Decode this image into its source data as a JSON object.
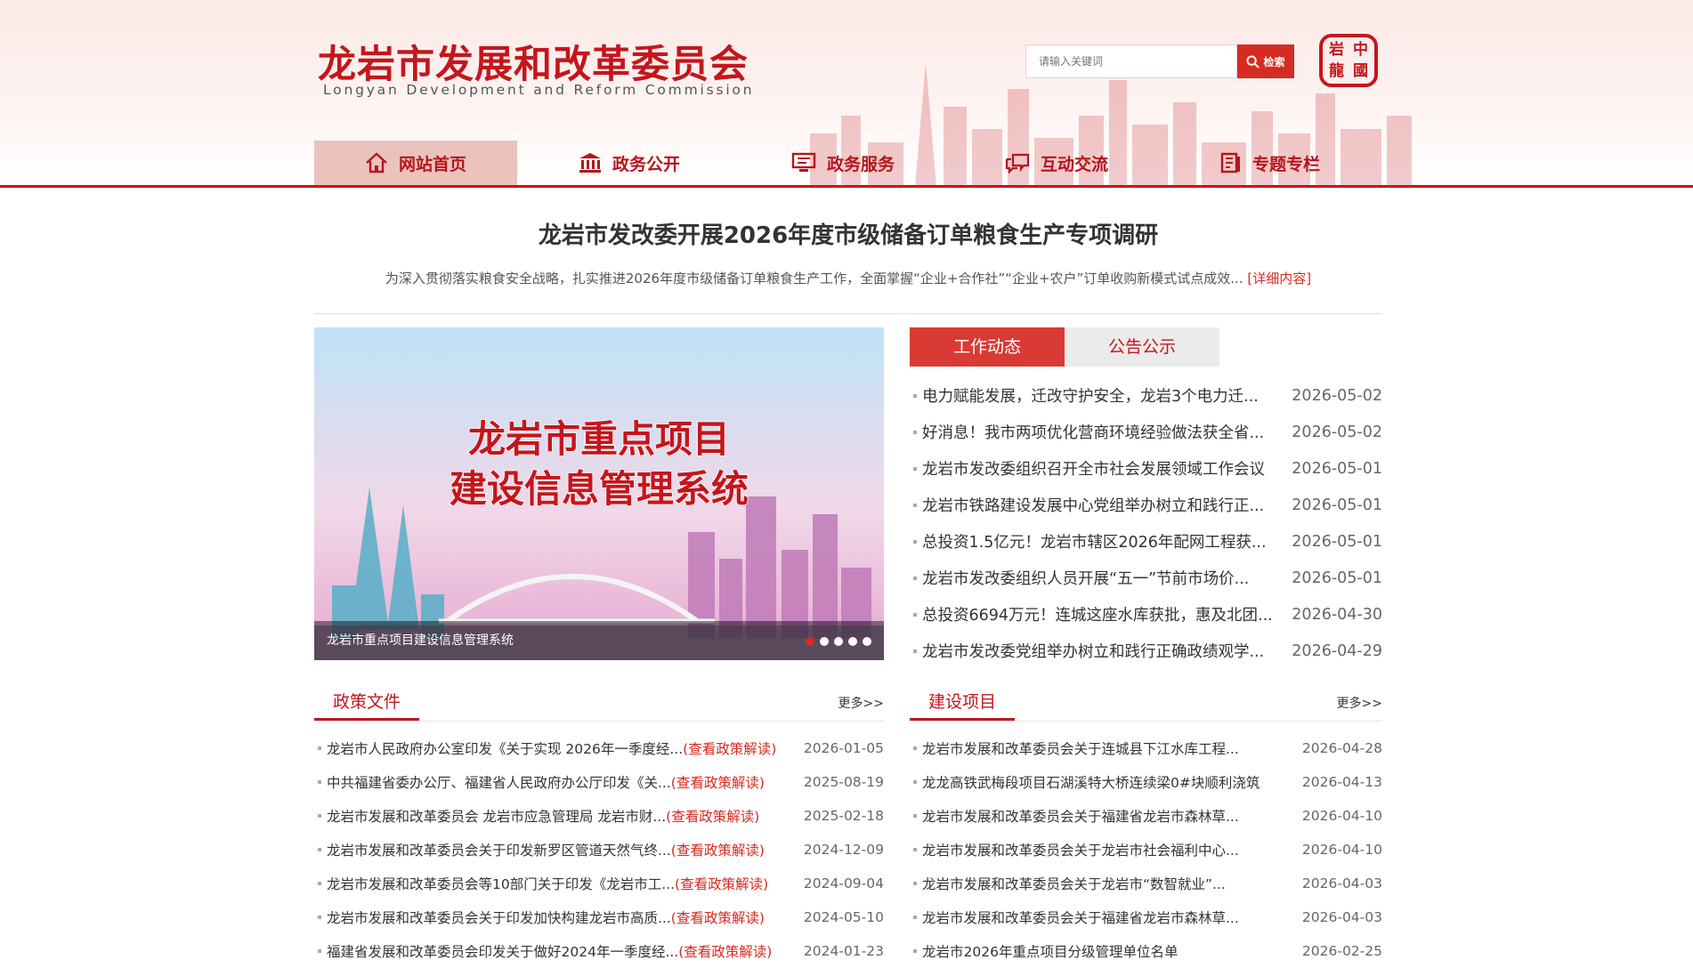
{
  "header": {
    "site_title": "龙岩市发展和改革委员会",
    "site_title_en": "Longyan Development and Reform Commission",
    "search_placeholder": "请输入关键词",
    "search_button": "检索",
    "seal_chars": [
      "中",
      "國",
      "龍",
      "岩"
    ]
  },
  "nav": [
    {
      "label": "网站首页",
      "icon": "home-icon",
      "active": true
    },
    {
      "label": "政务公开",
      "icon": "government-building-icon",
      "active": false
    },
    {
      "label": "政务服务",
      "icon": "service-screen-icon",
      "active": false
    },
    {
      "label": "互动交流",
      "icon": "chat-bubbles-icon",
      "active": false
    },
    {
      "label": "专题专栏",
      "icon": "column-book-icon",
      "active": false
    }
  ],
  "headline": {
    "title": "龙岩市发改委开展2026年度市级储备订单粮食生产专项调研",
    "summary": "为深入贯彻落实粮食安全战略，扎实推进2026年度市级储备订单粮食生产工作，全面掌握“企业+合作社”“企业+农户”订单收购新模式试点成效...",
    "more_link": "[详细内容]"
  },
  "banner": {
    "title_line1": "龙岩市重点项目",
    "title_line2": "建设信息管理系统",
    "caption": "龙岩市重点项目建设信息管理系统",
    "slide_count": 5,
    "active_slide": 1
  },
  "news_tabs": [
    "工作动态",
    "公告公示"
  ],
  "news": [
    {
      "title": "电力赋能发展，迁改守护安全，龙岩3个电力迁...",
      "date": "2026-05-02"
    },
    {
      "title": "好消息！我市两项优化营商环境经验做法获全省...",
      "date": "2026-05-02"
    },
    {
      "title": "龙岩市发改委组织召开全市社会发展领域工作会议",
      "date": "2026-05-01"
    },
    {
      "title": "龙岩市铁路建设发展中心党组举办树立和践行正...",
      "date": "2026-05-01"
    },
    {
      "title": "总投资1.5亿元！龙岩市辖区2026年配网工程获...",
      "date": "2026-05-01"
    },
    {
      "title": "龙岩市发改委组织人员开展“五一”节前市场价...",
      "date": "2026-05-01"
    },
    {
      "title": "总投资6694万元！连城这座水库获批，惠及北团...",
      "date": "2026-04-30"
    },
    {
      "title": "龙岩市发改委党组举办树立和践行正确政绩观学...",
      "date": "2026-04-29"
    }
  ],
  "policy": {
    "title": "政策文件",
    "more": "更多>>",
    "items": [
      {
        "title": "龙岩市人民政府办公室印发《关于实现 2026年一季度经...",
        "tag": "(查看政策解读)",
        "date": "2026-01-05"
      },
      {
        "title": "中共福建省委办公厅、福建省人民政府办公厅印发《关...",
        "tag": "(查看政策解读)",
        "date": "2025-08-19"
      },
      {
        "title": "龙岩市发展和改革委员会 龙岩市应急管理局 龙岩市财...",
        "tag": "(查看政策解读)",
        "date": "2025-02-18"
      },
      {
        "title": "龙岩市发展和改革委员会关于印发新罗区管道天然气终...",
        "tag": "(查看政策解读)",
        "date": "2024-12-09"
      },
      {
        "title": "龙岩市发展和改革委员会等10部门关于印发《龙岩市工...",
        "tag": "(查看政策解读)",
        "date": "2024-09-04"
      },
      {
        "title": "龙岩市发展和改革委员会关于印发加快构建龙岩市高质...",
        "tag": "(查看政策解读)",
        "date": "2024-05-10"
      },
      {
        "title": "福建省发展和改革委员会印发关于做好2024年一季度经...",
        "tag": "(查看政策解读)",
        "date": "2024-01-23"
      }
    ]
  },
  "projects": {
    "title": "建设项目",
    "more": "更多>>",
    "items": [
      {
        "title": "龙岩市发展和改革委员会关于连城县下江水库工程...",
        "date": "2026-04-28"
      },
      {
        "title": "龙龙高铁武梅段项目石湖溪特大桥连续梁0#块顺利浇筑",
        "date": "2026-04-13"
      },
      {
        "title": "龙岩市发展和改革委员会关于福建省龙岩市森林草...",
        "date": "2026-04-10"
      },
      {
        "title": "龙岩市发展和改革委员会关于龙岩市社会福利中心...",
        "date": "2026-04-10"
      },
      {
        "title": "龙岩市发展和改革委员会关于龙岩市“数智就业”...",
        "date": "2026-04-03"
      },
      {
        "title": "龙岩市发展和改革委员会关于福建省龙岩市森林草...",
        "date": "2026-04-03"
      },
      {
        "title": "龙岩市2026年重点项目分级管理单位名单",
        "date": "2026-02-25"
      }
    ]
  },
  "colors": {
    "brand_red": "#c4161c",
    "accent_red": "#d52b22",
    "tab_inactive": "#ebebeb"
  }
}
